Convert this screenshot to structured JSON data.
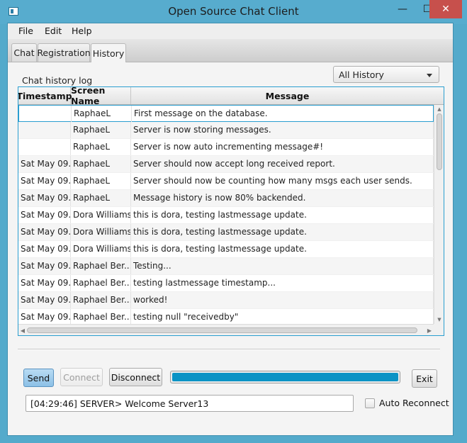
{
  "window": {
    "title": "Open Source Chat Client",
    "minimize_glyph": "—",
    "maximize_glyph": "☐",
    "close_glyph": "✕"
  },
  "menu": {
    "items": [
      "File",
      "Edit",
      "Help"
    ]
  },
  "tabs": [
    {
      "label": "Chat",
      "active": false
    },
    {
      "label": "Registration",
      "active": false
    },
    {
      "label": "History",
      "active": true
    }
  ],
  "history": {
    "section_label": "Chat history log",
    "filter": {
      "selected": "All History"
    },
    "columns": [
      "Timestamp",
      "Screen Name",
      "Message"
    ],
    "rows": [
      {
        "timestamp": "",
        "screen_name": "RaphaeL",
        "message": "First message on the database."
      },
      {
        "timestamp": "",
        "screen_name": "RaphaeL",
        "message": "Server is now storing messages."
      },
      {
        "timestamp": "",
        "screen_name": "RaphaeL",
        "message": "Server is now auto incrementing message#!"
      },
      {
        "timestamp": "Sat May 09...",
        "screen_name": "RaphaeL",
        "message": "Server should now accept long received report."
      },
      {
        "timestamp": "Sat May 09...",
        "screen_name": "RaphaeL",
        "message": "Server should now be counting how many msgs each user sends."
      },
      {
        "timestamp": "Sat May 09...",
        "screen_name": "RaphaeL",
        "message": "Message history is now  80% backended."
      },
      {
        "timestamp": "Sat May 09...",
        "screen_name": "Dora Williams",
        "message": "this is dora, testing lastmessage update."
      },
      {
        "timestamp": "Sat May 09...",
        "screen_name": "Dora Williams",
        "message": "this is dora, testing lastmessage update."
      },
      {
        "timestamp": "Sat May 09...",
        "screen_name": "Dora Williams",
        "message": "this is dora, testing lastmessage update."
      },
      {
        "timestamp": "Sat May 09...",
        "screen_name": "Raphael Ber...",
        "message": "Testing..."
      },
      {
        "timestamp": "Sat May 09...",
        "screen_name": "Raphael Ber...",
        "message": "testing lastmessage timestamp..."
      },
      {
        "timestamp": "Sat May 09...",
        "screen_name": "Raphael Ber...",
        "message": "worked!"
      },
      {
        "timestamp": "Sat May 09...",
        "screen_name": "Raphael Ber...",
        "message": "testing null \"receivedby\""
      }
    ]
  },
  "controls": {
    "send_label": "Send",
    "connect_label": "Connect",
    "disconnect_label": "Disconnect",
    "exit_label": "Exit",
    "progress": 1.0,
    "status_value": "[04:29:46] SERVER> Welcome Server13",
    "auto_reconnect_label": "Auto Reconnect",
    "auto_reconnect_checked": false
  },
  "colors": {
    "accent": "#0b93c5",
    "selection_border": "#2a9ed0",
    "close_button": "#c7504c"
  }
}
